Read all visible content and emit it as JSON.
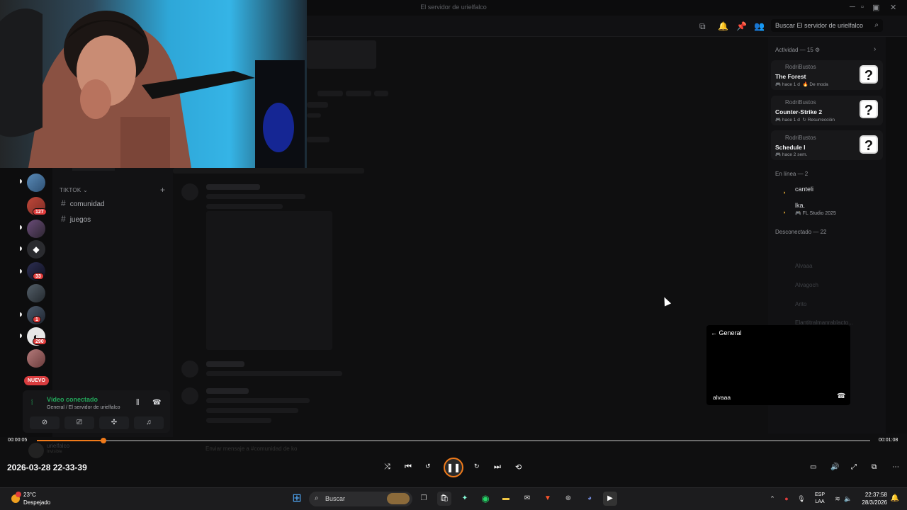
{
  "window": {
    "title": "El servidor de urielfalco",
    "search_placeholder": "Buscar El servidor de urielfalco"
  },
  "servers": {
    "badges": [
      "127",
      "33",
      "1",
      "290"
    ],
    "new_label": "NUEVO"
  },
  "channels": {
    "category": "TIKTOK",
    "items": [
      {
        "label": "comunidad"
      },
      {
        "label": "juegos"
      }
    ]
  },
  "voice": {
    "title": "Vídeo conectado",
    "subtitle": "General / El servidor de urielfalco"
  },
  "activity": {
    "title": "Actividad — 15",
    "cards": [
      {
        "user": "RodriBustos",
        "game": "The Forest",
        "time": "hace 1 d",
        "tag": "De moda"
      },
      {
        "user": "RodriBustos",
        "game": "Counter-Strike 2",
        "time": "hace 1 d",
        "tag": "Resurrección"
      },
      {
        "user": "RodriBustos",
        "game": "Schedule I",
        "time": "hace 2 sem.",
        "tag": ""
      }
    ]
  },
  "members": {
    "online_title": "En línea — 2",
    "online": [
      {
        "name": "canteli",
        "status": ""
      },
      {
        "name": "lka.",
        "status": "FL Studio 2025"
      }
    ],
    "offline_title": "Desconectado — 22",
    "offline": [
      "Alvaaa",
      "Alvagoch",
      "Arito",
      "Elantitralmanrablacto..."
    ]
  },
  "popout": {
    "back_label": "General",
    "participant": "alvaaa"
  },
  "player": {
    "elapsed": "00:00:05",
    "duration": "00:01:08",
    "progress_fraction": 0.08,
    "recorded_at": "2026-03-28 22-33-39",
    "accent_color": "#f07a1a"
  },
  "footer": {
    "username": "urielfalco",
    "status": "Invisible",
    "message_placeholder": "Enviar mensaje a #comunidad de ko"
  },
  "taskbar": {
    "weather_temp": "23°C",
    "weather_desc": "Despejado",
    "search_label": "Buscar",
    "lang_line1": "ESP",
    "lang_line2": "LAA",
    "time": "22:37:58",
    "date": "28/3/2026"
  }
}
